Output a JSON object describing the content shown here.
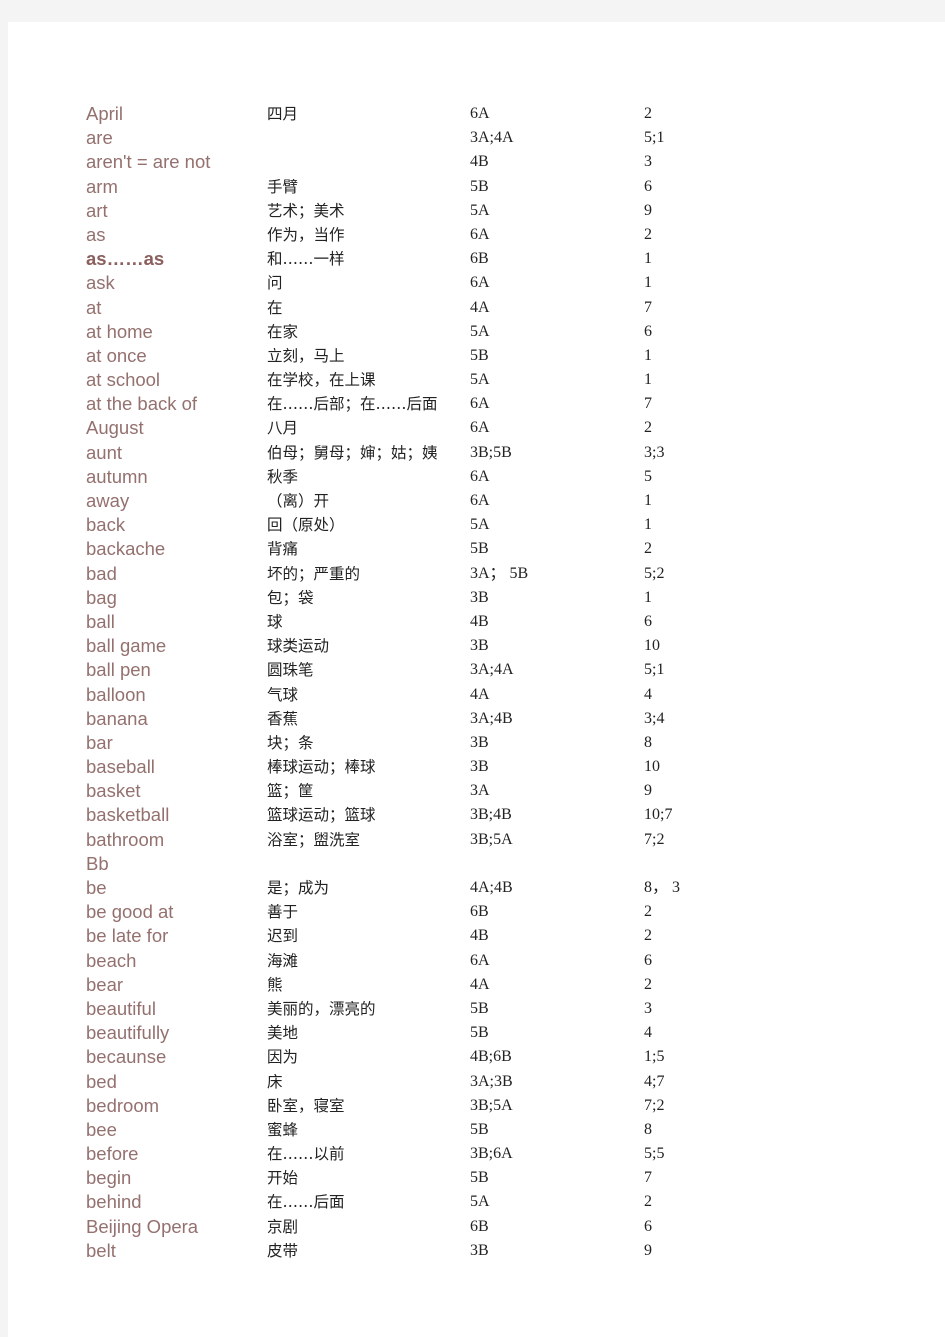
{
  "vocabulary": [
    {
      "word": "April",
      "meaning": "四月",
      "book": "6A",
      "unit": "2"
    },
    {
      "word": "are",
      "meaning": "",
      "book": "3A;4A",
      "unit": "5;1"
    },
    {
      "word": "aren't = are not",
      "meaning": "",
      "book": "4B",
      "unit": "3"
    },
    {
      "word": "arm",
      "meaning": "手臂",
      "book": "5B",
      "unit": "6"
    },
    {
      "word": "art",
      "meaning": "艺术；美术",
      "book": "5A",
      "unit": "9"
    },
    {
      "word": "as",
      "meaning": "作为，当作",
      "book": "6A",
      "unit": "2"
    },
    {
      "word": "as……as",
      "meaning": "和……一样",
      "book": "6B",
      "unit": "1",
      "emphasis": true
    },
    {
      "word": "ask",
      "meaning": "问",
      "book": "6A",
      "unit": "1"
    },
    {
      "word": "at",
      "meaning": "在",
      "book": "4A",
      "unit": "7"
    },
    {
      "word": "at home",
      "meaning": "在家",
      "book": "5A",
      "unit": "6"
    },
    {
      "word": "at once",
      "meaning": "立刻，马上",
      "book": "5B",
      "unit": "1"
    },
    {
      "word": "at school",
      "meaning": "在学校，在上课",
      "book": "5A",
      "unit": "1"
    },
    {
      "word": "at the back of",
      "meaning": "在……后部；在……后面",
      "book": "6A",
      "unit": "7"
    },
    {
      "word": "August",
      "meaning": "八月",
      "book": "6A",
      "unit": "2"
    },
    {
      "word": "aunt",
      "meaning": "伯母；舅母；婶；姑；姨",
      "book": "3B;5B",
      "unit": "3;3"
    },
    {
      "word": "autumn",
      "meaning": "秋季",
      "book": "6A",
      "unit": "5"
    },
    {
      "word": "away",
      "meaning": "（离）开",
      "book": "6A",
      "unit": "1"
    },
    {
      "word": "back",
      "meaning": "回（原处）",
      "book": "5A",
      "unit": "1"
    },
    {
      "word": "backache",
      "meaning": "背痛",
      "book": "5B",
      "unit": "2"
    },
    {
      "word": "bad",
      "meaning": "坏的；严重的",
      "book": "3A； 5B",
      "unit": "5;2"
    },
    {
      "word": "bag",
      "meaning": "包；袋",
      "book": "3B",
      "unit": "1"
    },
    {
      "word": "ball",
      "meaning": "球",
      "book": "4B",
      "unit": "6"
    },
    {
      "word": "ball game",
      "meaning": "球类运动",
      "book": "3B",
      "unit": "10"
    },
    {
      "word": "ball pen",
      "meaning": "圆珠笔",
      "book": "3A;4A",
      "unit": "5;1"
    },
    {
      "word": "balloon",
      "meaning": "气球",
      "book": "4A",
      "unit": "4"
    },
    {
      "word": "banana",
      "meaning": "香蕉",
      "book": "3A;4B",
      "unit": "3;4"
    },
    {
      "word": "bar",
      "meaning": "块；条",
      "book": "3B",
      "unit": "8"
    },
    {
      "word": "baseball",
      "meaning": "棒球运动；棒球",
      "book": "3B",
      "unit": "10"
    },
    {
      "word": "basket",
      "meaning": "篮；筐",
      "book": "3A",
      "unit": "9"
    },
    {
      "word": "basketball",
      "meaning": "篮球运动；篮球",
      "book": "3B;4B",
      "unit": "10;7"
    },
    {
      "word": "bathroom",
      "meaning": "浴室；盥洗室",
      "book": "3B;5A",
      "unit": "7;2"
    },
    {
      "word": "Bb",
      "meaning": "",
      "book": "",
      "unit": ""
    },
    {
      "word": "be",
      "meaning": "是；成为",
      "book": "4A;4B",
      "unit": "8， 3"
    },
    {
      "word": "be good at",
      "meaning": "善于",
      "book": "6B",
      "unit": "2"
    },
    {
      "word": "be late for",
      "meaning": "迟到",
      "book": "4B",
      "unit": "2"
    },
    {
      "word": "beach",
      "meaning": "海滩",
      "book": "6A",
      "unit": "6"
    },
    {
      "word": "bear",
      "meaning": "熊",
      "book": "4A",
      "unit": "2"
    },
    {
      "word": "beautiful",
      "meaning": "美丽的，漂亮的",
      "book": "5B",
      "unit": "3"
    },
    {
      "word": "beautifully",
      "meaning": "美地",
      "book": "5B",
      "unit": "4"
    },
    {
      "word": "becaunse",
      "meaning": "因为",
      "book": "4B;6B",
      "unit": "1;5"
    },
    {
      "word": "bed",
      "meaning": "床",
      "book": "3A;3B",
      "unit": "4;7"
    },
    {
      "word": "bedroom",
      "meaning": "卧室，寝室",
      "book": "3B;5A",
      "unit": "7;2"
    },
    {
      "word": "bee",
      "meaning": "蜜蜂",
      "book": "5B",
      "unit": "8"
    },
    {
      "word": "before",
      "meaning": "在……以前",
      "book": "3B;6A",
      "unit": "5;5"
    },
    {
      "word": "begin",
      "meaning": "开始",
      "book": "5B",
      "unit": "7"
    },
    {
      "word": "behind",
      "meaning": "在……后面",
      "book": "5A",
      "unit": "2"
    },
    {
      "word": "Beijing Opera",
      "meaning": "京剧",
      "book": "6B",
      "unit": "6"
    },
    {
      "word": "belt",
      "meaning": "皮带",
      "book": "3B",
      "unit": "9"
    }
  ]
}
